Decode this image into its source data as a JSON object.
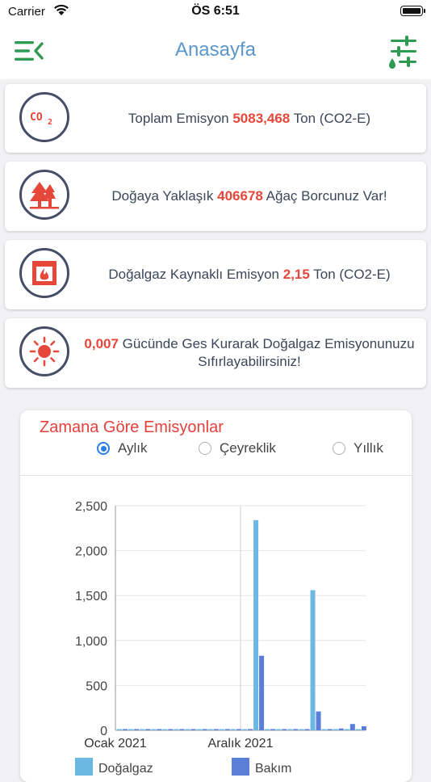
{
  "status_bar": {
    "carrier": "Carrier",
    "time": "ÖS 6:51"
  },
  "nav": {
    "title": "Anasayfa"
  },
  "cards": [
    {
      "icon": "co2-icon",
      "pre": "Toplam Emisyon ",
      "value": "5083,468",
      "post": " Ton (CO2-E)"
    },
    {
      "icon": "tree-icon",
      "pre": "Doğaya Yaklaşık ",
      "value": "406678",
      "post": " Ağaç Borcunuz Var!"
    },
    {
      "icon": "fireplace-icon",
      "pre": "Doğalgaz Kaynaklı Emisyon ",
      "value": "2,15",
      "post": " Ton (CO2-E)"
    },
    {
      "icon": "sun-icon",
      "pre": "",
      "value": "0,007",
      "post": " Gücünde Ges Kurarak Doğalgaz Emisyonunuzu Sıfırlayabilirsiniz!"
    }
  ],
  "chart_section": {
    "title": "Zamana Göre Emisyonlar",
    "options": [
      "Aylık",
      "Çeyreklik",
      "Yıllık"
    ],
    "selected": "Aylık"
  },
  "colors": {
    "accent": "#5b96cc",
    "highlight": "#e5483b",
    "green": "#2e9a52",
    "series1": "#6bb8e3",
    "series2": "#5b7ed8"
  },
  "chart_data": {
    "type": "bar",
    "ylim": [
      0,
      2500
    ],
    "yticks": [
      "0",
      "500",
      "1,000",
      "1,500",
      "2,000",
      "2,500"
    ],
    "xlabels": [
      {
        "label": "Ocak 2021",
        "index": 0
      },
      {
        "label": "Aralık 2021",
        "index": 11
      }
    ],
    "n_periods": 22,
    "series": [
      {
        "name": "Doğalgaz",
        "values": [
          0,
          0,
          0,
          0,
          0,
          0,
          0,
          0,
          0,
          0,
          0,
          0,
          2340,
          0,
          0,
          0,
          0,
          1560,
          0,
          0,
          0,
          0
        ]
      },
      {
        "name": "Bakım",
        "values": [
          0,
          0,
          0,
          0,
          0,
          0,
          0,
          0,
          0,
          0,
          0,
          0,
          830,
          0,
          0,
          0,
          0,
          210,
          10,
          20,
          70,
          45
        ]
      }
    ],
    "grid": true
  }
}
